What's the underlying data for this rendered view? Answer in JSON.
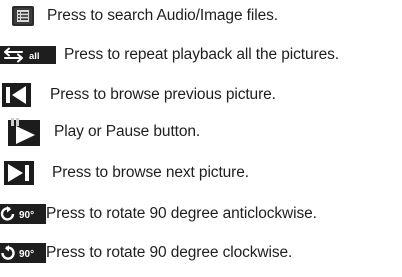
{
  "icons": {
    "search": "search-list-icon",
    "repeat_all": "repeat-all-icon",
    "previous": "previous-picture-icon",
    "play_pause": "play-pause-icon",
    "next": "next-picture-icon",
    "rotate_ccw": "rotate-anticlockwise-90-icon",
    "rotate_cw": "rotate-clockwise-90-icon"
  },
  "items": [
    {
      "label": "Press to search Audio/Image files.",
      "icon_text": ""
    },
    {
      "label": "Press to repeat playback all the pictures.",
      "icon_text": "all"
    },
    {
      "label": "Press to browse previous picture.",
      "icon_text": ""
    },
    {
      "label": "Play or Pause button.",
      "icon_text": ""
    },
    {
      "label": "Press to browse next picture.",
      "icon_text": ""
    },
    {
      "label": "Press to rotate 90 degree anticlockwise.",
      "icon_text": "90°"
    },
    {
      "label": "Press to rotate 90 degree clockwise.",
      "icon_text": "90°"
    }
  ]
}
